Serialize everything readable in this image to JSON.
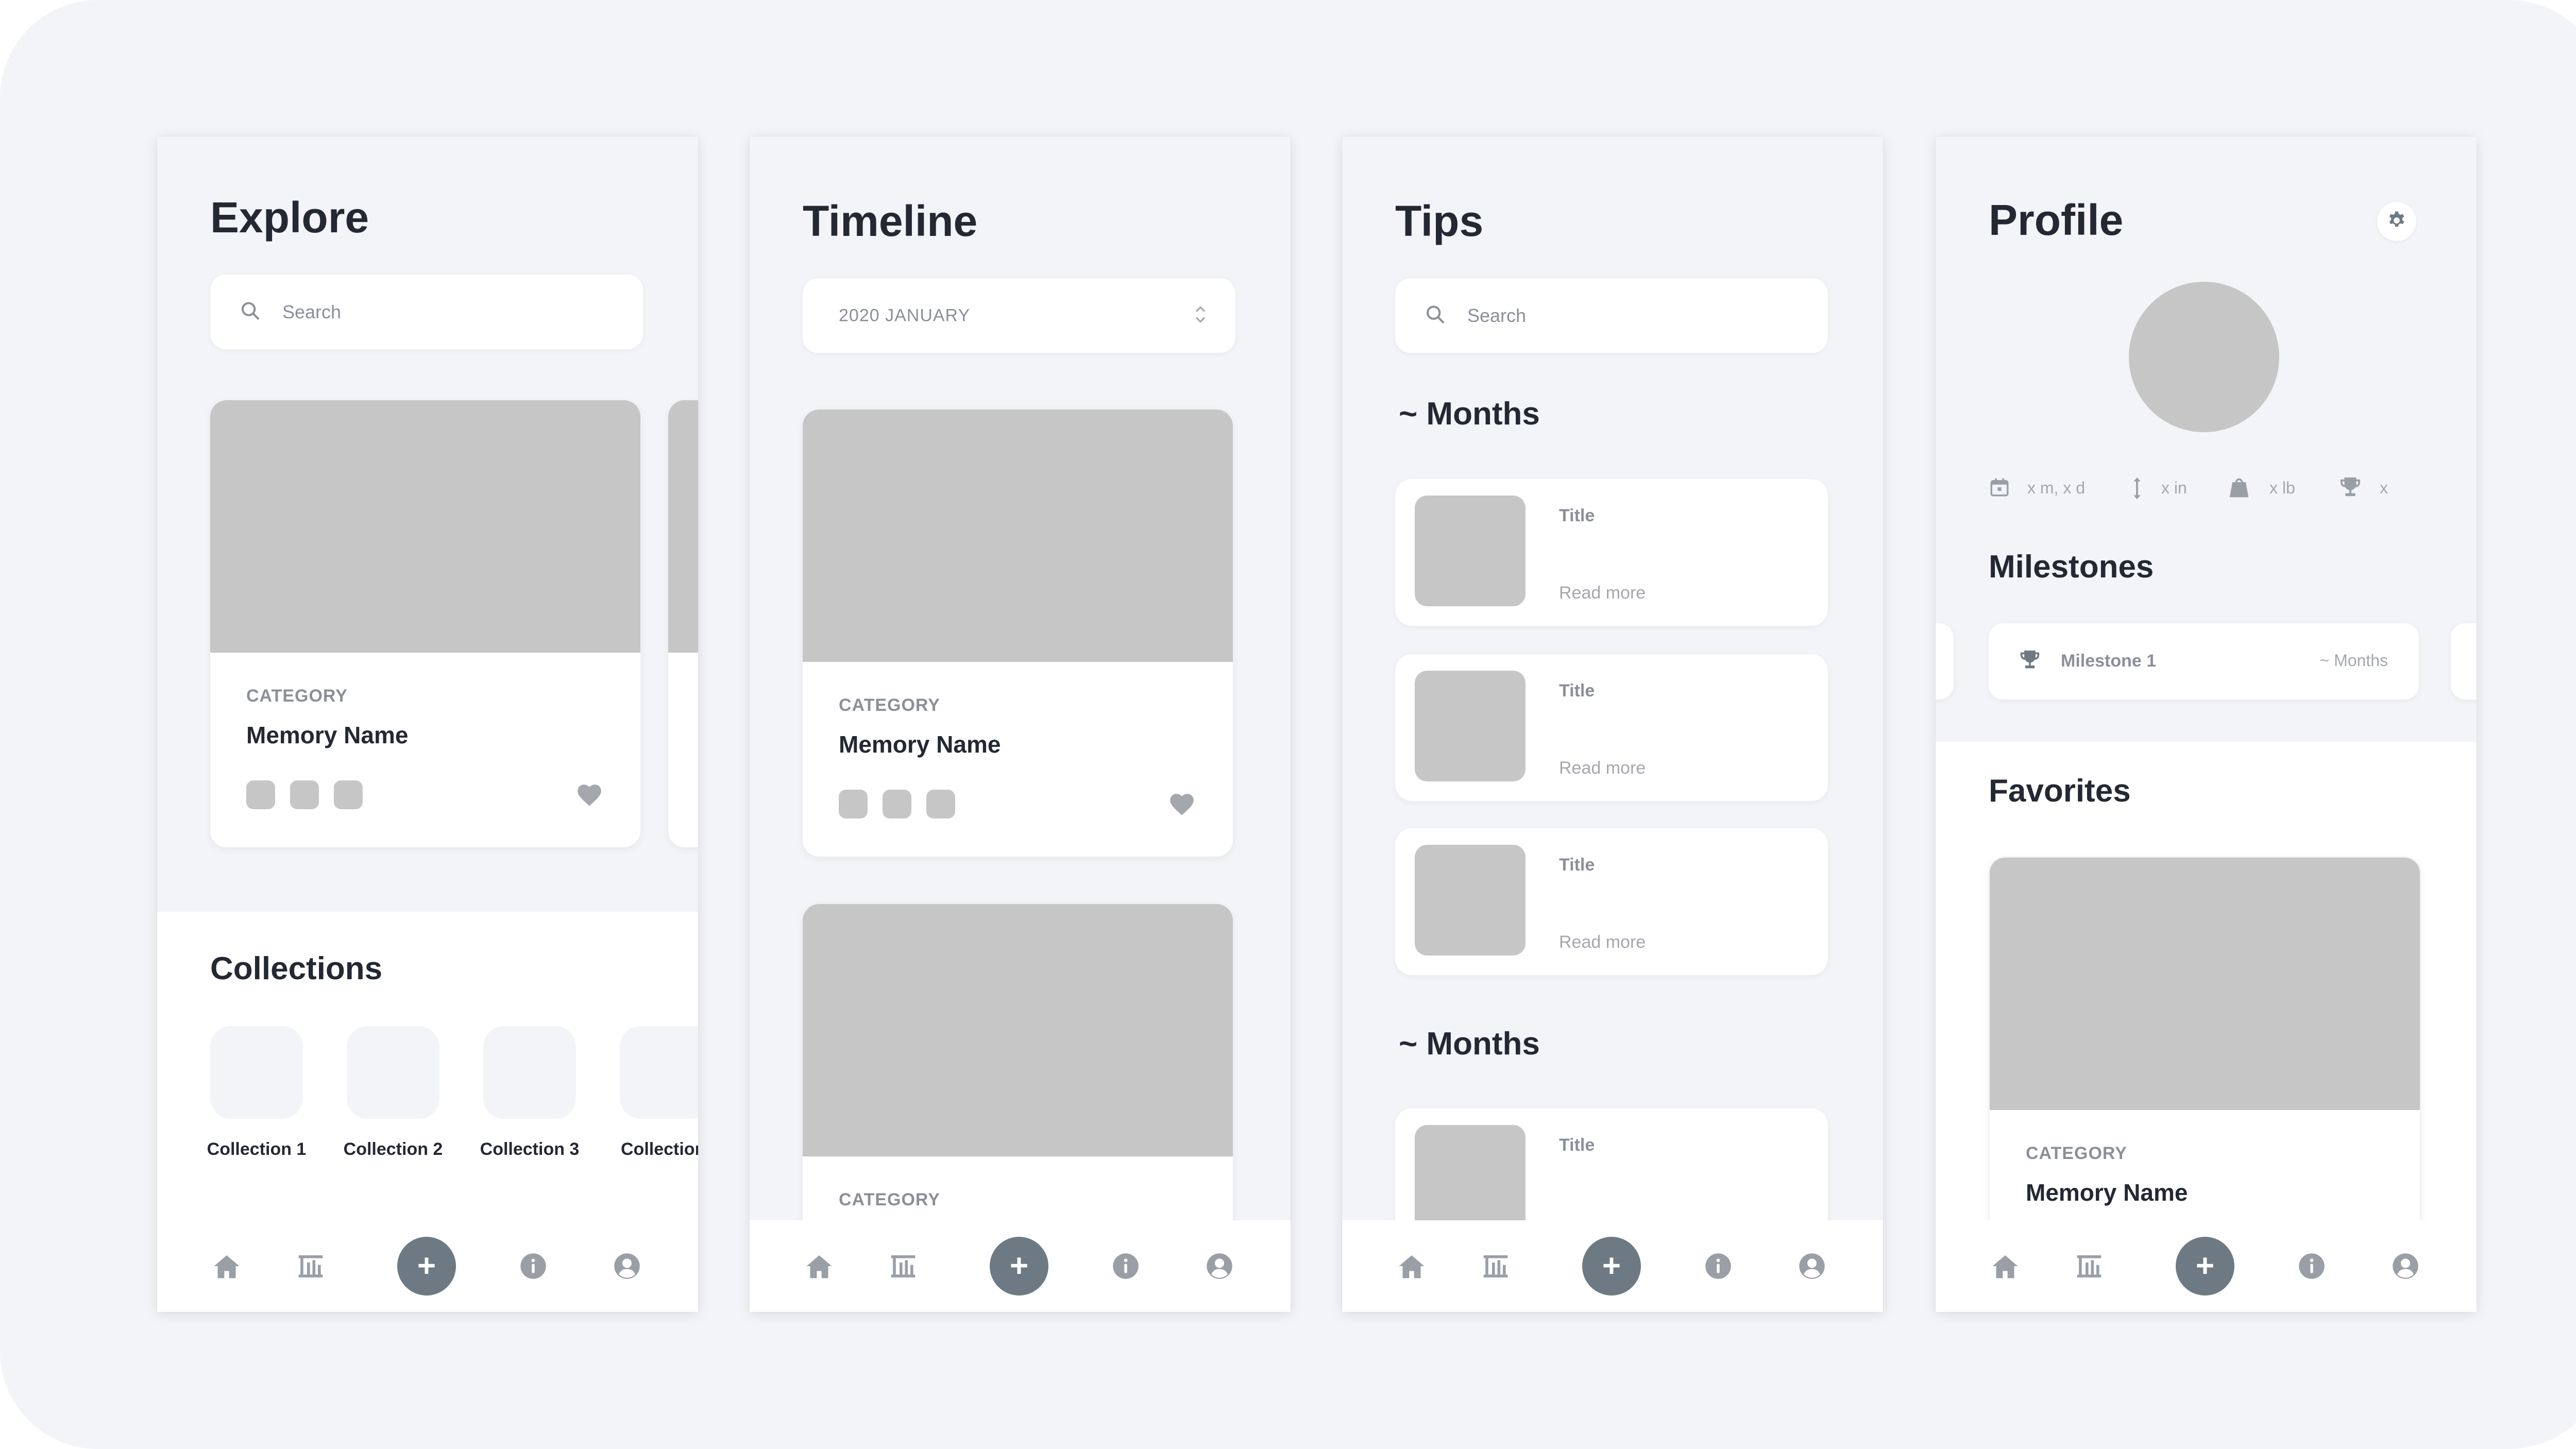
{
  "colors": {
    "background": "#f3f4f8",
    "placeholder": "#c6c6c6",
    "text_dark": "#242833",
    "text_muted": "#8b8f99",
    "fab": "#6e7a83"
  },
  "nav": {
    "icons": [
      "home-icon",
      "graph-icon",
      "add-icon",
      "info-icon",
      "profile-icon"
    ],
    "add_label": "+"
  },
  "explore": {
    "title": "Explore",
    "search_placeholder": "Search",
    "card": {
      "category": "CATEGORY",
      "name": "Memory Name"
    },
    "collections_title": "Collections",
    "collections": [
      "Collection 1",
      "Collection 2",
      "Collection 3",
      "Collection"
    ]
  },
  "timeline": {
    "title": "Timeline",
    "date_select": "2020 JANUARY",
    "card1": {
      "category": "CATEGORY",
      "name": "Memory Name"
    },
    "card2": {
      "category": "CATEGORY"
    }
  },
  "tips": {
    "title": "Tips",
    "search_placeholder": "Search",
    "section1": "~ Months",
    "section2": "~ Months",
    "items": [
      {
        "title": "Title",
        "more": "Read more"
      },
      {
        "title": "Title",
        "more": "Read more"
      },
      {
        "title": "Title",
        "more": "Read more"
      },
      {
        "title": "Title"
      }
    ]
  },
  "profile": {
    "title": "Profile",
    "stats": {
      "age": "x m, x d",
      "height": "x in",
      "weight": "x lb",
      "trophies": "x"
    },
    "milestones_title": "Milestones",
    "milestone": {
      "name": "Milestone 1",
      "time": "~ Months"
    },
    "favorites_title": "Favorites",
    "favorite": {
      "category": "CATEGORY",
      "name": "Memory Name"
    }
  }
}
